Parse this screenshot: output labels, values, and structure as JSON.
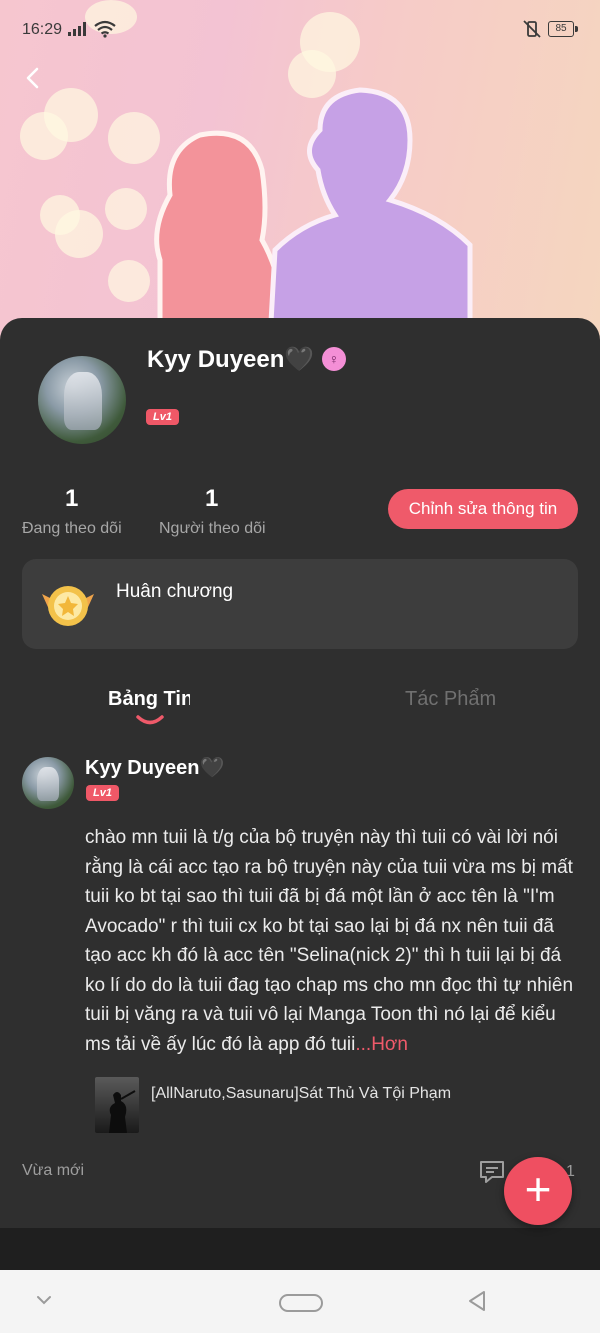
{
  "status_bar": {
    "time": "16:29",
    "battery": "85",
    "signal_icon": "signal-icon",
    "wifi_icon": "wifi-icon",
    "mute_icon": "vibrate-off-icon"
  },
  "header": {
    "back_icon": "back-arrow-icon"
  },
  "profile": {
    "name": "Kyy Duyeen🖤",
    "gender_icon": "female-icon",
    "level": "Lv1",
    "following_count": "1",
    "following_label": "Đang theo dõi",
    "followers_count": "1",
    "followers_label": "Người theo dõi",
    "edit_button": "Chỉnh sửa thông tin",
    "medal_label": "Huân chương"
  },
  "tabs": [
    {
      "label": "Bảng Tin",
      "active": true
    },
    {
      "label": "Tác Phẩm",
      "active": false
    }
  ],
  "post": {
    "author": "Kyy Duyeen🖤",
    "level": "Lv1",
    "text": "chào mn tuii là t/g của bộ truyện này thì tuii có vài lời nói rằng là cái acc tạo ra bộ truyện này của tuii vừa ms bị mất tuii ko bt tại sao thì tuii đã bị đá một lần ở acc tên là \"I'm Avocado\" r thì tuii cx ko bt tại sao lại bị đá nx nên tuii đã tạo acc kh đó là acc tên \"Selina(nick 2)\" thì h tuii lại bị đá ko lí do do là tuii đag tạo chap ms cho mn đọc thì tự nhiên tuii bị văng ra và tuii vô lại Manga Toon thì nó lại để kiểu ms tải về ấy lúc đó là app đó tuii",
    "more": "...Hơn",
    "book_title": "[AllNaruto,Sasunaru]Sát Thủ Và Tội Phạm",
    "time": "Vừa mới",
    "comment_count": "1"
  },
  "fab": {
    "label": "+"
  },
  "colors": {
    "accent": "#ef5a6a",
    "card_bg": "#2f2f2f",
    "panel_bg": "#3d3d3d"
  }
}
